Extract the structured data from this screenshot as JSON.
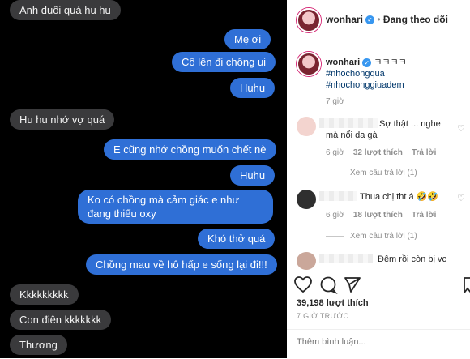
{
  "chat": {
    "messages": [
      {
        "side": "in",
        "text": "Anh duối quá hu hu"
      },
      {
        "side": "out",
        "text": "Mẹ ơi"
      },
      {
        "side": "out",
        "text": "Cố lên đi chồng ui"
      },
      {
        "side": "out",
        "text": "Huhu"
      },
      {
        "side": "in",
        "text": "Hu hu nhớ vợ quá"
      },
      {
        "side": "out",
        "text": "E cũng nhớ chồng muốn chết nè"
      },
      {
        "side": "out",
        "text": "Huhu"
      },
      {
        "side": "out",
        "text": "Ko có chồng mà cảm giác e như đang thiếu oxy"
      },
      {
        "side": "out",
        "text": "Khó thở quá"
      },
      {
        "side": "out",
        "text": "Chồng mau về hô hấp e sống lại đi!!!"
      },
      {
        "side": "in",
        "text": "Kkkkkkkkk"
      },
      {
        "side": "in",
        "text": "Con điên kkkkkkk"
      },
      {
        "side": "in",
        "text": "Thương"
      }
    ]
  },
  "instagram": {
    "header": {
      "username": "wonhari",
      "separator": "•",
      "follow_label": "Đang theo dõi"
    },
    "caption": {
      "username": "wonhari",
      "text": "ㅋㅋㅋㅋ",
      "hashtags": [
        "#nhochongqua",
        "#nhochonggiuadem"
      ],
      "time": "7 giờ"
    },
    "comments": [
      {
        "text": "Sợ thật ... nghe mà nổi da gà",
        "time": "6 giờ",
        "likes": "32 lượt thích",
        "reply_label": "Trả lời",
        "view_replies": "Xem câu trả lời (1)"
      },
      {
        "text": "Thua chị tht á 🤣🤣",
        "time": "6 giờ",
        "likes": "18 lượt thích",
        "reply_label": "Trả lời",
        "view_replies": "Xem câu trả lời (1)"
      },
      {
        "text": "Đêm rồi còn bị vc"
      }
    ],
    "likes_count": "39,198 lượt thích",
    "post_time": "7 GIỜ TRƯỚC",
    "comment_placeholder": "Thêm bình luận..."
  }
}
